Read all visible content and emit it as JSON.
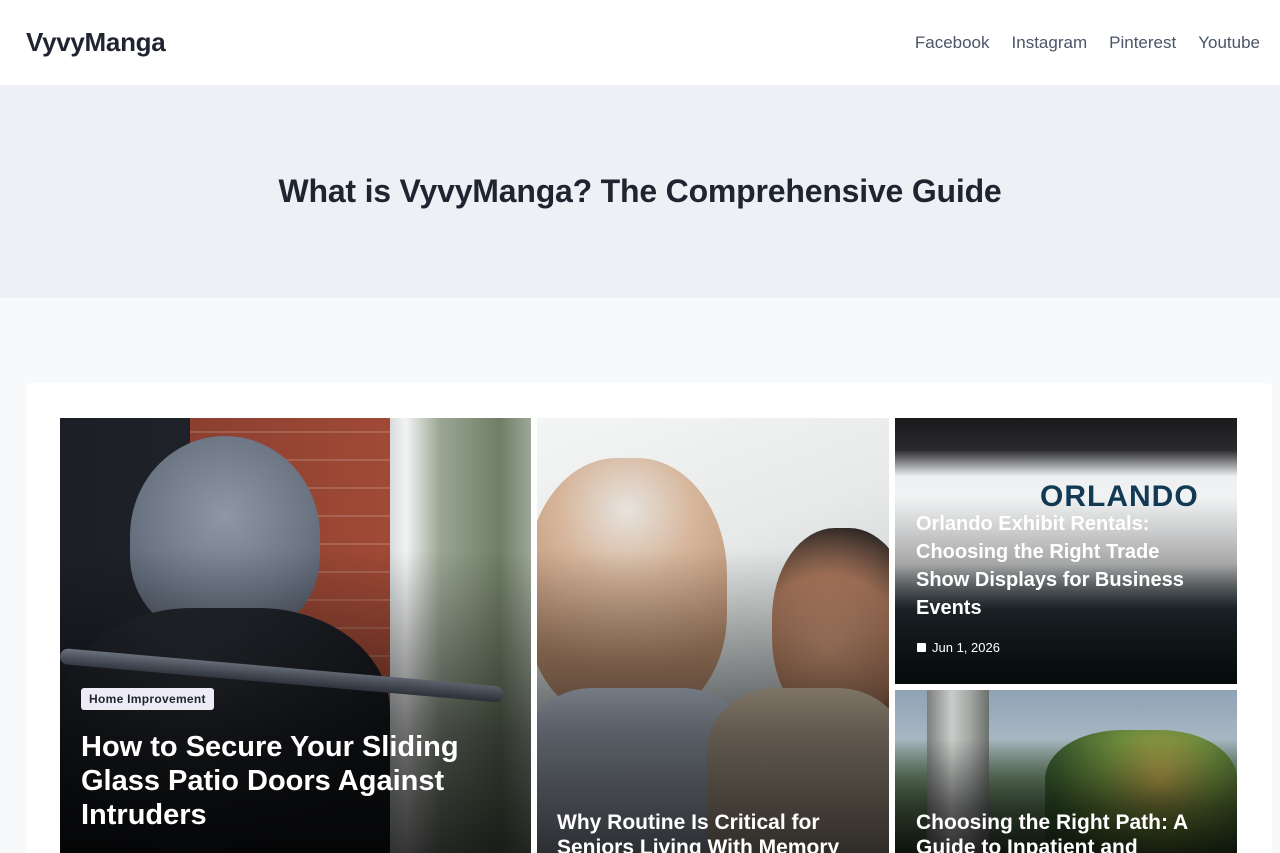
{
  "site": {
    "logo": "VyvyManga"
  },
  "nav": {
    "items": [
      "Facebook",
      "Instagram",
      "Pinterest",
      "Youtube"
    ]
  },
  "hero": {
    "title": "What is VyvyManga? The Comprehensive Guide"
  },
  "posts": [
    {
      "category": "Home Improvement",
      "title": "How to Secure Your Sliding Glass Patio Doors Against Intruders"
    },
    {
      "title": "Why Routine Is Critical for Seniors Living With Memory"
    },
    {
      "title": "Orlando Exhibit Rentals: Choosing the Right Trade Show Displays for Business Events",
      "date": "Jun 1, 2026",
      "image_sign": "ORLANDO"
    },
    {
      "title": "Choosing the Right Path: A Guide to Inpatient and"
    }
  ],
  "icons": {
    "date": "calendar-icon"
  },
  "colors": {
    "hero_bg": "#edf1f6",
    "page_bg": "#f7f9fb",
    "text": "#1f2430",
    "badge_bg": "#ecebf6"
  }
}
